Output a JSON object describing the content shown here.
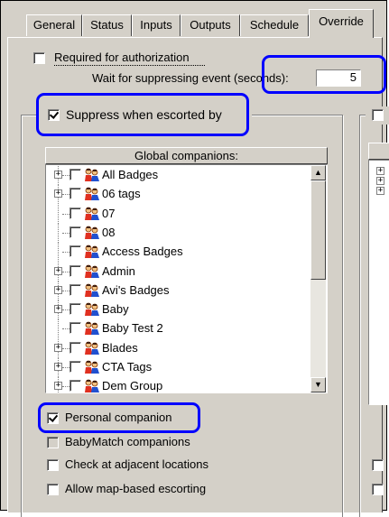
{
  "tabs": [
    {
      "label": "General"
    },
    {
      "label": "Status"
    },
    {
      "label": "Inputs"
    },
    {
      "label": "Outputs"
    },
    {
      "label": "Schedule"
    },
    {
      "label": "Override"
    }
  ],
  "active_tab": "Override",
  "override": {
    "required_for_authorization": {
      "label": "Required for authorization",
      "checked": false
    },
    "wait_label": "Wait for suppressing event (seconds):",
    "wait_value": "5",
    "suppress_when_escorted": {
      "label": "Suppress when escorted by",
      "checked": true
    },
    "global_companions_header": "Global companions:",
    "companions": [
      {
        "label": "All Badges",
        "expandable": true,
        "checked": false
      },
      {
        "label": "06 tags",
        "expandable": true,
        "checked": false
      },
      {
        "label": "07",
        "expandable": false,
        "checked": false
      },
      {
        "label": "08",
        "expandable": false,
        "checked": false
      },
      {
        "label": "Access Badges",
        "expandable": false,
        "checked": false
      },
      {
        "label": "Admin",
        "expandable": true,
        "checked": false
      },
      {
        "label": "Avi's Badges",
        "expandable": true,
        "checked": false
      },
      {
        "label": "Baby",
        "expandable": true,
        "checked": false
      },
      {
        "label": "Baby Test 2",
        "expandable": false,
        "checked": false
      },
      {
        "label": "Blades",
        "expandable": true,
        "checked": false
      },
      {
        "label": "CTA Tags",
        "expandable": true,
        "checked": false
      },
      {
        "label": "Dem Group",
        "expandable": true,
        "checked": false
      }
    ],
    "personal_companion": {
      "label": "Personal companion",
      "checked": true
    },
    "babymatch_companions": {
      "label": "BabyMatch companions",
      "checked": false
    },
    "check_adjacent": {
      "label": "Check at adjacent locations",
      "checked": false
    },
    "allow_map_escorting": {
      "label": "Allow map-based escorting",
      "checked": false
    }
  },
  "highlight_color": "#0000ff"
}
